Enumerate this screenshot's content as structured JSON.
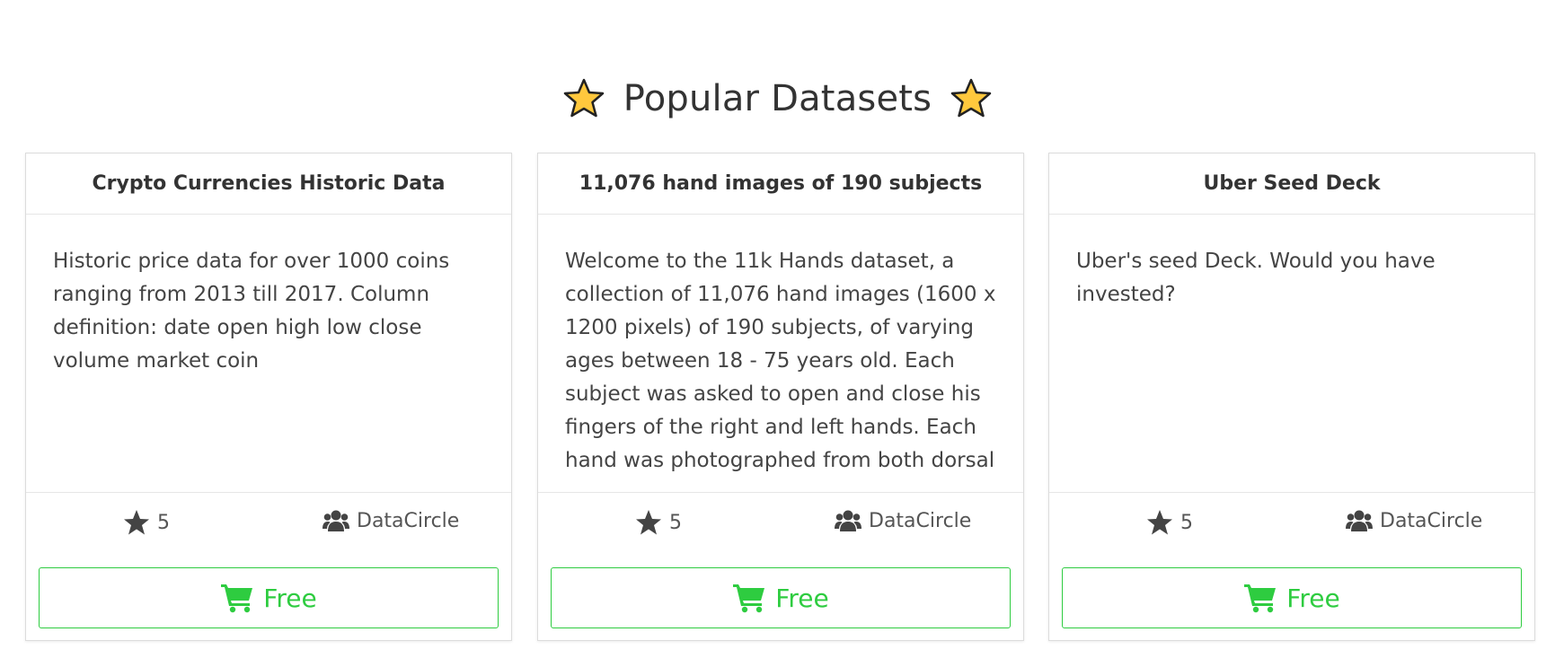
{
  "heading": {
    "title": "Popular Datasets",
    "icon_left": "star-icon",
    "icon_right": "star-icon"
  },
  "colors": {
    "accent_green": "#2ecc40",
    "star_fill": "#ffc83d",
    "text": "#333333"
  },
  "cards": [
    {
      "title": "Crypto Currencies Historic Data",
      "description": "Historic price data for over 1000 coins ranging from 2013 till 2017. Column definition: date open high low close volume market coin",
      "rating": "5",
      "owner": "DataCircle",
      "button_label": "Free"
    },
    {
      "title": "11,076 hand images of 190 subjects",
      "description": "Welcome to the 11k Hands dataset, a collection of 11,076 hand images (1600 x 1200 pixels) of 190 subjects, of varying ages between 18 - 75 years old. Each subject was asked to open and close his fingers of the right and left hands. Each hand was photographed from both dorsal",
      "rating": "5",
      "owner": "DataCircle",
      "button_label": "Free"
    },
    {
      "title": "Uber Seed Deck",
      "description": "Uber's seed Deck. Would you have invested?",
      "rating": "5",
      "owner": "DataCircle",
      "button_label": "Free"
    }
  ]
}
